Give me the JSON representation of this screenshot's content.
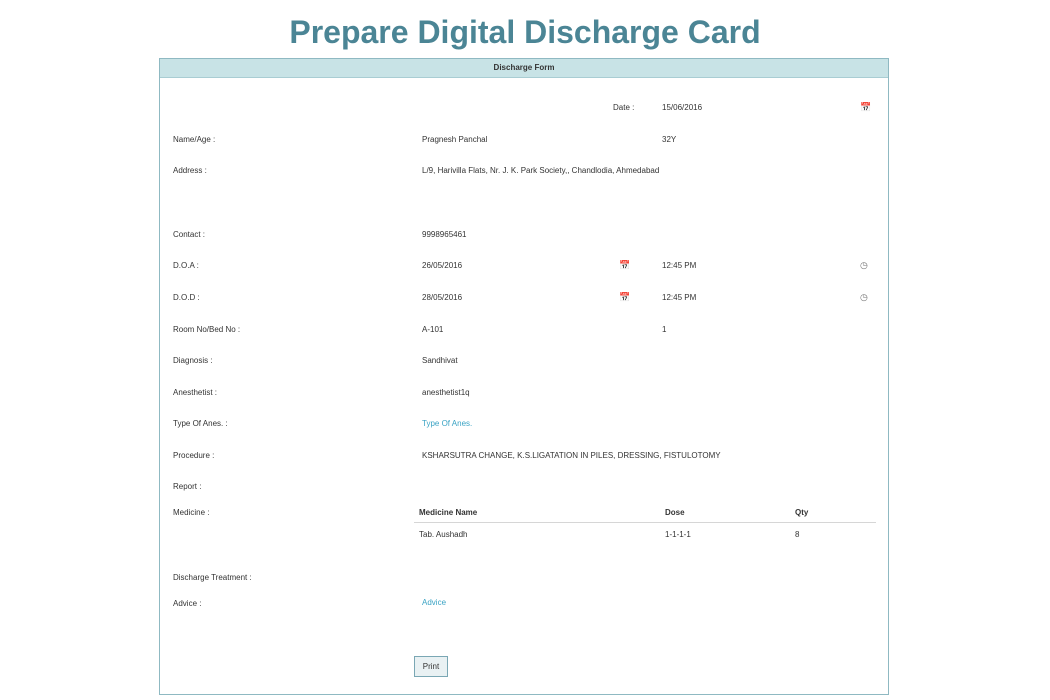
{
  "page_title": "Prepare Digital Discharge Card",
  "form_header": "Discharge Form",
  "fields": {
    "date": {
      "label": "Date :",
      "value": "15/06/2016",
      "icon": "calendar-icon"
    },
    "name_age": {
      "label": "Name/Age :",
      "name": "Pragnesh Panchal",
      "age": "32Y"
    },
    "address": {
      "label": "Address :",
      "value": "L/9, Harivilla Flats, Nr. J. K. Park Society,, Chandlodia, Ahmedabad"
    },
    "contact": {
      "label": "Contact :",
      "value": "9998965461"
    },
    "doa": {
      "label": "D.O.A :",
      "date": "26/05/2016",
      "time": "12:45 PM"
    },
    "dod": {
      "label": "D.O.D :",
      "date": "28/05/2016",
      "time": "12:45 PM"
    },
    "room_bed": {
      "label": "Room No/Bed No :",
      "room": "A-101",
      "bed": "1"
    },
    "diagnosis": {
      "label": "Diagnosis :",
      "value": "Sandhivat"
    },
    "anesthetist": {
      "label": "Anesthetist :",
      "value": "anesthetist1q"
    },
    "type_of_anes": {
      "label": "Type Of Anes. :",
      "value": "Type Of Anes."
    },
    "procedure": {
      "label": "Procedure :",
      "value": "KSHARSUTRA CHANGE, K.S.LIGATATION IN PILES, DRESSING, FISTULOTOMY"
    },
    "report": {
      "label": "Report :"
    },
    "medicine": {
      "label": "Medicine :",
      "columns": [
        "Medicine Name",
        "Dose",
        "Qty"
      ],
      "rows": [
        {
          "name": "Tab. Aushadh",
          "dose": "1-1-1-1",
          "qty": "8"
        }
      ]
    },
    "discharge_treatment": {
      "label": "Discharge Treatment :"
    },
    "advice": {
      "label": "Advice :",
      "value": "Advice"
    }
  },
  "buttons": {
    "print": "Print"
  },
  "colors": {
    "title": "#4b8595",
    "header_bg": "#c8e3e6",
    "link": "#3aa3c4",
    "border": "#8fb9c2"
  }
}
